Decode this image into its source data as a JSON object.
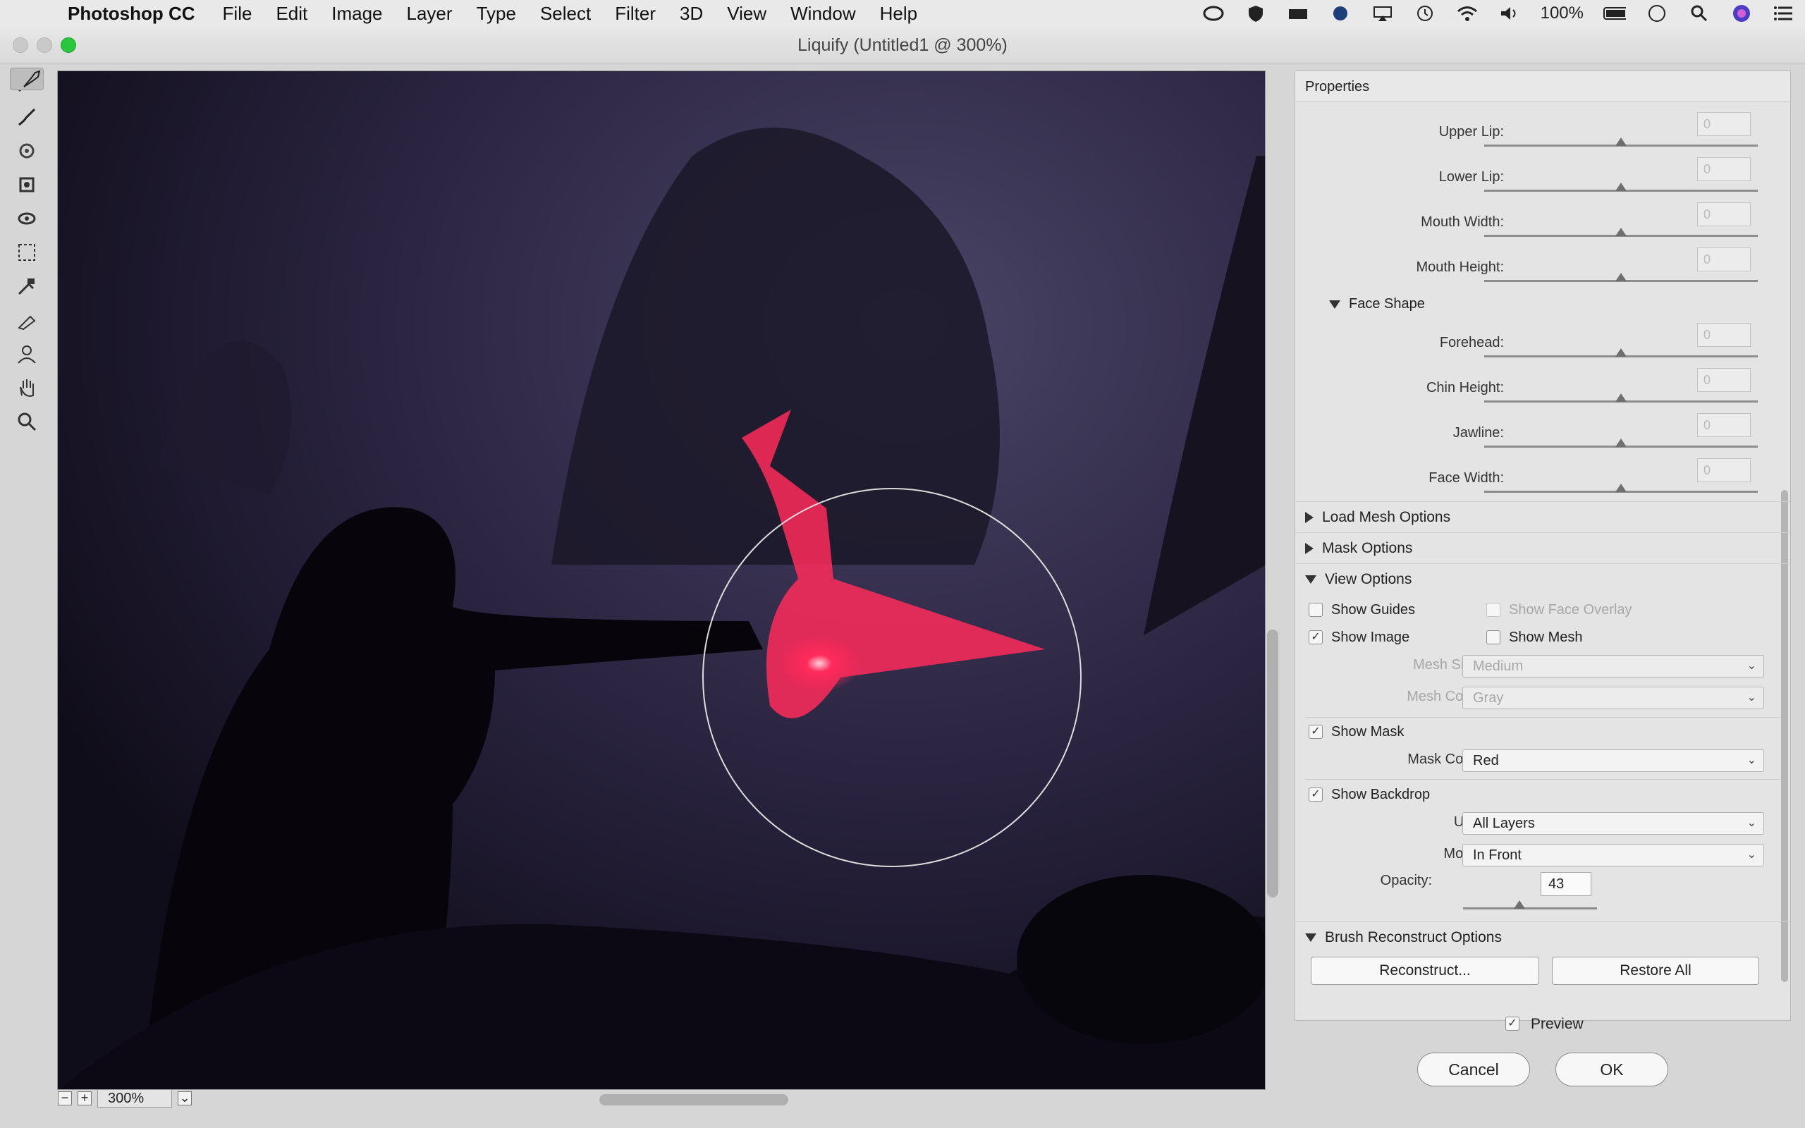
{
  "menubar": {
    "app_name": "Photoshop CC",
    "items": [
      "File",
      "Edit",
      "Image",
      "Layer",
      "Type",
      "Select",
      "Filter",
      "3D",
      "View",
      "Window",
      "Help"
    ],
    "battery": "100%"
  },
  "window": {
    "title": "Liquify (Untitled1 @ 300%)"
  },
  "tools": [
    "forward-warp",
    "reconstruct",
    "smooth",
    "twirl-clockwise",
    "pucker",
    "bloat",
    "push-left",
    "freeze-mask",
    "thaw-mask",
    "face",
    "hand",
    "zoom"
  ],
  "zoom": {
    "value": "300%",
    "minus": "−",
    "plus": "+",
    "chevron": "⌄"
  },
  "panel": {
    "title": "Properties",
    "mouth_sliders": [
      {
        "label": "Upper Lip:",
        "value": "0"
      },
      {
        "label": "Lower Lip:",
        "value": "0"
      },
      {
        "label": "Mouth Width:",
        "value": "0"
      },
      {
        "label": "Mouth Height:",
        "value": "0"
      }
    ],
    "face_shape": {
      "title": "Face Shape",
      "sliders": [
        {
          "label": "Forehead:",
          "value": "0"
        },
        {
          "label": "Chin Height:",
          "value": "0"
        },
        {
          "label": "Jawline:",
          "value": "0"
        },
        {
          "label": "Face Width:",
          "value": "0"
        }
      ]
    },
    "load_mesh": "Load Mesh Options",
    "mask_options": "Mask Options",
    "view_options": {
      "title": "View Options",
      "show_guides": "Show Guides",
      "show_face_overlay": "Show Face Overlay",
      "show_image": "Show Image",
      "show_mesh": "Show Mesh",
      "mesh_size_label": "Mesh Size:",
      "mesh_size": "Medium",
      "mesh_color_label": "Mesh Color:",
      "mesh_color": "Gray",
      "show_mask": "Show Mask",
      "mask_color_label": "Mask Color:",
      "mask_color": "Red",
      "show_backdrop": "Show Backdrop",
      "use_label": "Use:",
      "use": "All Layers",
      "mode_label": "Mode:",
      "mode": "In Front",
      "opacity_label": "Opacity:",
      "opacity": "43"
    },
    "brush_reconstruct": {
      "title": "Brush Reconstruct Options",
      "reconstruct": "Reconstruct...",
      "restore_all": "Restore All"
    }
  },
  "preview": "Preview",
  "cancel": "Cancel",
  "ok": "OK",
  "colors": {
    "canvas_bg": "#13101f",
    "mask": "#ff2a5a",
    "accent_green": "#2ac63c"
  }
}
